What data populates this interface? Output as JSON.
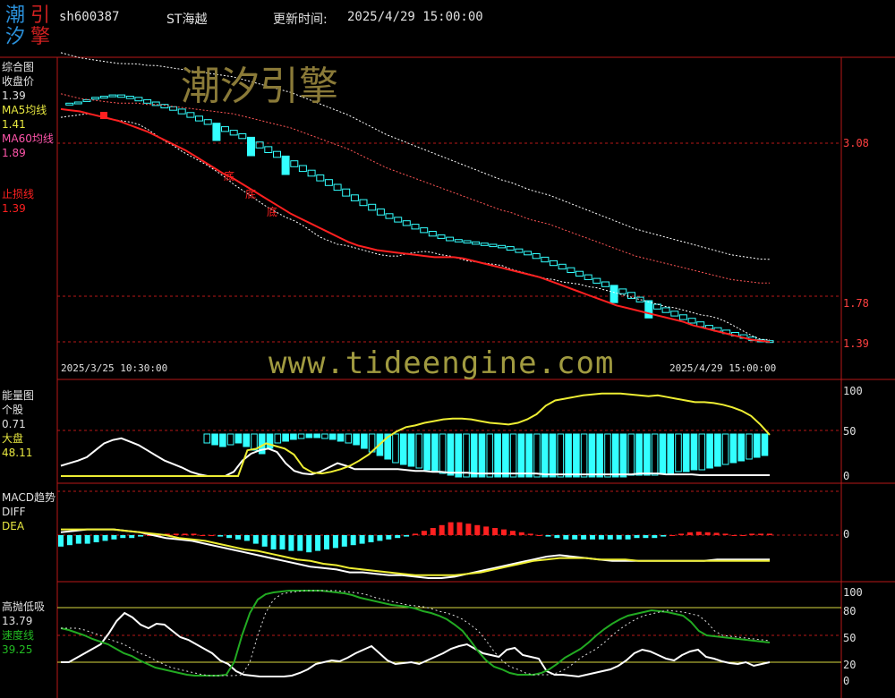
{
  "header": {
    "logo": {
      "c1": "潮",
      "c2": "引",
      "c3": "汐",
      "c4": "擎"
    },
    "code": "sh600387",
    "name": "ST海越",
    "update_label": "更新时间:",
    "update_value": "2025/4/29 15:00:00"
  },
  "watermark": {
    "brand": "潮汐引擎",
    "website": "www.tideengine.com"
  },
  "colors": {
    "bg": "#000000",
    "frame": "#b81818",
    "candle": "#33ffff",
    "ma5": "#ffffff",
    "ma60": "#ff5555",
    "stoploss": "#ff2020",
    "energy_stock": "#ffffff",
    "energy_market": "#eeee33",
    "macd_diff": "#ffffff",
    "macd_dea": "#eeee33",
    "macd_pos": "#ff2020",
    "macd_neg": "#33ffff",
    "sell_buy": "#ffffff",
    "speed": "#22aa22"
  },
  "panel1": {
    "labels": {
      "title": "综合图",
      "close": "收盘价",
      "close_val": "1.39",
      "ma5": "MA5均线",
      "ma5_val": "1.41",
      "ma60": "MA60均线",
      "ma60_val": "1.89",
      "stop": "止损线",
      "stop_val": "1.39"
    },
    "bottom_marker": "底",
    "date_start": "2025/3/25 10:30:00",
    "date_end": "2025/4/29 15:00:00"
  },
  "panel2": {
    "labels": {
      "title": "能量图",
      "stock": "个股",
      "stock_val": "0.71",
      "market": "大盘",
      "market_val": "48.11"
    }
  },
  "panel3": {
    "labels": {
      "title": "MACD趋势",
      "diff": "DIFF",
      "dea": "DEA"
    }
  },
  "panel4": {
    "labels": {
      "title": "高抛低吸",
      "val1": "13.79",
      "speed": "速度线",
      "speed_val": "39.25"
    }
  },
  "chart_data": [
    {
      "type": "candlestick",
      "title": "综合图",
      "y_ticks": [
        "3.08",
        "1.78",
        "1.39"
      ],
      "ylim": [
        1.3,
        3.75
      ],
      "series": [
        {
          "name": "收盘价",
          "values": [
            3.4,
            3.42,
            3.43,
            3.45,
            3.47,
            3.48,
            3.48,
            3.47,
            3.46,
            3.44,
            3.42,
            3.4,
            3.38,
            3.36,
            3.33,
            3.3,
            3.27,
            3.24,
            3.21,
            3.18,
            3.15,
            3.12,
            3.08,
            3.04,
            3.0,
            2.96,
            2.92,
            2.88,
            2.84,
            2.8,
            2.76,
            2.72,
            2.68,
            2.63,
            2.59,
            2.55,
            2.51,
            2.47,
            2.44,
            2.41,
            2.38,
            2.35,
            2.32,
            2.29,
            2.27,
            2.25,
            2.24,
            2.23,
            2.22,
            2.21,
            2.2,
            2.19,
            2.17,
            2.15,
            2.13,
            2.1,
            2.07,
            2.04,
            2.01,
            1.98,
            1.95,
            1.92,
            1.89,
            1.86,
            1.83,
            1.8,
            1.76,
            1.73,
            1.7,
            1.67,
            1.64,
            1.61,
            1.58,
            1.55,
            1.52,
            1.5,
            1.48,
            1.46,
            1.44,
            1.42,
            1.4,
            1.39,
            1.39
          ]
        },
        {
          "name": "MA5均线",
          "values": [
            3.3,
            3.31,
            3.32,
            3.33,
            3.32,
            3.3,
            3.28,
            3.27,
            3.26,
            3.24,
            3.2,
            3.15,
            3.1,
            3.06,
            3.01,
            2.97,
            2.93,
            2.89,
            2.84,
            2.79,
            2.73,
            2.68,
            2.63,
            2.58,
            2.53,
            2.49,
            2.45,
            2.42,
            2.38,
            2.33,
            2.28,
            2.25,
            2.22,
            2.21,
            2.19,
            2.17,
            2.15,
            2.13,
            2.12,
            2.12,
            2.14,
            2.15,
            2.16,
            2.15,
            2.13,
            2.12,
            2.1,
            2.08,
            2.07,
            2.06,
            2.05,
            2.04,
            2.01,
            1.99,
            1.97,
            1.95,
            1.93,
            1.92,
            1.9,
            1.89,
            1.88,
            1.86,
            1.85,
            1.83,
            1.81,
            1.79,
            1.77,
            1.75,
            1.73,
            1.71,
            1.69,
            1.68,
            1.66,
            1.64,
            1.62,
            1.61,
            1.59,
            1.56,
            1.52,
            1.48,
            1.44,
            1.41,
            1.41
          ]
        },
        {
          "name": "MA60均线",
          "values": [
            3.5,
            3.48,
            3.46,
            3.45,
            3.44,
            3.43,
            3.42,
            3.42,
            3.42,
            3.41,
            3.41,
            3.4,
            3.39,
            3.38,
            3.37,
            3.36,
            3.35,
            3.34,
            3.33,
            3.31,
            3.29,
            3.27,
            3.25,
            3.23,
            3.21,
            3.18,
            3.15,
            3.12,
            3.09,
            3.06,
            3.03,
            2.99,
            2.95,
            2.91,
            2.87,
            2.84,
            2.81,
            2.78,
            2.75,
            2.72,
            2.69,
            2.66,
            2.63,
            2.6,
            2.57,
            2.54,
            2.51,
            2.49,
            2.46,
            2.43,
            2.41,
            2.39,
            2.36,
            2.33,
            2.3,
            2.27,
            2.24,
            2.21,
            2.18,
            2.15,
            2.12,
            2.1,
            2.08,
            2.06,
            2.04,
            2.02,
            2.0,
            1.98,
            1.96,
            1.94,
            1.92,
            1.91,
            1.9,
            1.89,
            1.89
          ]
        },
        {
          "name": "止损线",
          "values": [
            3.37,
            3.36,
            3.35,
            3.33,
            3.31,
            3.29,
            3.27,
            3.24,
            3.21,
            3.18,
            3.14,
            3.1,
            3.06,
            3.02,
            2.97,
            2.92,
            2.87,
            2.82,
            2.78,
            2.73,
            2.68,
            2.63,
            2.58,
            2.53,
            2.48,
            2.44,
            2.4,
            2.36,
            2.32,
            2.28,
            2.24,
            2.21,
            2.19,
            2.17,
            2.16,
            2.15,
            2.14,
            2.13,
            2.12,
            2.11,
            2.11,
            2.11,
            2.1,
            2.08,
            2.06,
            2.04,
            2.02,
            2.0,
            1.98,
            1.96,
            1.94,
            1.91,
            1.88,
            1.85,
            1.82,
            1.79,
            1.76,
            1.73,
            1.7,
            1.68,
            1.66,
            1.64,
            1.62,
            1.6,
            1.58,
            1.56,
            1.53,
            1.51,
            1.49,
            1.47,
            1.45,
            1.43,
            1.41,
            1.4,
            1.39
          ]
        }
      ]
    },
    {
      "type": "bar",
      "title": "能量图",
      "y_ticks": [
        "100",
        "50",
        "0"
      ],
      "ylim": [
        0,
        100
      ],
      "series": [
        {
          "name": "个股",
          "values": [
            12,
            15,
            18,
            22,
            30,
            38,
            42,
            44,
            40,
            36,
            30,
            24,
            18,
            14,
            10,
            5,
            2,
            0,
            0,
            0,
            5,
            18,
            26,
            30,
            32,
            28,
            15,
            6,
            3,
            2,
            5,
            10,
            15,
            12,
            8,
            8,
            8,
            8,
            8,
            8,
            7,
            6,
            6,
            5,
            5,
            4,
            4,
            4,
            3,
            3,
            3,
            3,
            3,
            3,
            3,
            3,
            2,
            2,
            2,
            2,
            2,
            2,
            2,
            2,
            2,
            2,
            2,
            3,
            3,
            3,
            2,
            2,
            2,
            2,
            1,
            1,
            1,
            1,
            1,
            1,
            1,
            1,
            1
          ]
        },
        {
          "name": "大盘",
          "values": [
            0,
            0,
            0,
            0,
            0,
            0,
            0,
            0,
            0,
            0,
            0,
            0,
            0,
            0,
            0,
            0,
            0,
            0,
            0,
            0,
            30,
            32,
            38,
            35,
            32,
            25,
            10,
            4,
            3,
            5,
            8,
            12,
            18,
            25,
            35,
            45,
            52,
            57,
            59,
            62,
            64,
            66,
            67,
            67,
            66,
            64,
            62,
            61,
            60,
            62,
            66,
            72,
            82,
            88,
            90,
            92,
            94,
            95,
            96,
            96,
            96,
            95,
            94,
            93,
            94,
            92,
            90,
            88,
            86,
            86,
            85,
            83,
            80,
            76,
            70,
            60,
            48
          ]
        },
        {
          "name": "柱",
          "values": [
            -10,
            -12,
            -14,
            -12,
            -10,
            -14,
            -18,
            -22,
            -16,
            -10,
            -8,
            -6,
            -5,
            -4,
            -4,
            -5,
            -6,
            -8,
            -10,
            -12,
            -16,
            -20,
            -24,
            -28,
            -32,
            -34,
            -36,
            -38,
            -40,
            -42,
            -44,
            -46,
            -48,
            -48,
            -48,
            -48,
            -48,
            -48,
            -48,
            -48,
            -48,
            -48,
            -48,
            -48,
            -48,
            -48,
            -48,
            -48,
            -48,
            -48,
            -48,
            -48,
            -48,
            -48,
            -46,
            -46,
            -46,
            -46,
            -44,
            -44,
            -42,
            -42,
            -40,
            -40,
            -38,
            -36,
            -34,
            -32,
            -30,
            -28,
            -26,
            -24
          ]
        }
      ]
    },
    {
      "type": "line",
      "title": "MACD趋势",
      "y_ticks": [
        "0"
      ],
      "series": [
        {
          "name": "DIFF",
          "values": [
            0.01,
            0.015,
            0.02,
            0.02,
            0.02,
            0.015,
            0.01,
            0,
            -0.01,
            -0.015,
            -0.02,
            -0.03,
            -0.04,
            -0.05,
            -0.06,
            -0.07,
            -0.08,
            -0.09,
            -0.1,
            -0.11,
            -0.115,
            -0.12,
            -0.13,
            -0.13,
            -0.135,
            -0.14,
            -0.14,
            -0.145,
            -0.15,
            -0.15,
            -0.145,
            -0.135,
            -0.125,
            -0.115,
            -0.105,
            -0.095,
            -0.085,
            -0.075,
            -0.07,
            -0.075,
            -0.08,
            -0.085,
            -0.09,
            -0.09,
            -0.09,
            -0.09,
            -0.09,
            -0.09,
            -0.09,
            -0.09,
            -0.085,
            -0.085,
            -0.085,
            -0.085,
            -0.085
          ]
        },
        {
          "name": "DEA",
          "values": [
            0.02,
            0.02,
            0.02,
            0.02,
            0.02,
            0.015,
            0.01,
            0.005,
            0,
            -0.01,
            -0.015,
            -0.02,
            -0.03,
            -0.04,
            -0.05,
            -0.055,
            -0.065,
            -0.075,
            -0.085,
            -0.09,
            -0.1,
            -0.105,
            -0.115,
            -0.12,
            -0.125,
            -0.13,
            -0.135,
            -0.14,
            -0.14,
            -0.14,
            -0.14,
            -0.135,
            -0.13,
            -0.12,
            -0.11,
            -0.1,
            -0.09,
            -0.085,
            -0.08,
            -0.08,
            -0.08,
            -0.085,
            -0.085,
            -0.085,
            -0.09,
            -0.09,
            -0.09,
            -0.09,
            -0.09,
            -0.09,
            -0.09,
            -0.09,
            -0.09,
            -0.09,
            -0.09
          ]
        },
        {
          "name": "MACD柱",
          "values": [
            -0.04,
            -0.035,
            -0.03,
            -0.03,
            -0.025,
            -0.02,
            -0.015,
            -0.01,
            -0.01,
            -0.005,
            0,
            0,
            0.005,
            0.005,
            0.005,
            0.005,
            0,
            0,
            -0.005,
            -0.01,
            -0.015,
            -0.02,
            -0.03,
            -0.04,
            -0.05,
            -0.05,
            -0.055,
            -0.055,
            -0.06,
            -0.055,
            -0.05,
            -0.045,
            -0.04,
            -0.035,
            -0.03,
            -0.025,
            -0.02,
            -0.015,
            -0.01,
            -0.005,
            0.005,
            0.015,
            0.025,
            0.035,
            0.045,
            0.045,
            0.04,
            0.035,
            0.03,
            0.025,
            0.02,
            0.015,
            0.01,
            0.005,
            0,
            -0.005,
            -0.01,
            -0.015,
            -0.015,
            -0.015,
            -0.015,
            -0.015,
            -0.015,
            -0.015,
            -0.015,
            -0.01,
            -0.01,
            -0.01,
            -0.005,
            0,
            0.005,
            0.01,
            0.012,
            0.01,
            0.008,
            0.005,
            0,
            0,
            0.005,
            0.005,
            0.005
          ]
        }
      ]
    },
    {
      "type": "line",
      "title": "高抛低吸",
      "y_ticks": [
        "100",
        "80",
        "50",
        "20",
        "0"
      ],
      "ylim": [
        0,
        100
      ],
      "series": [
        {
          "name": "高抛低吸",
          "values": [
            20,
            20,
            25,
            30,
            35,
            40,
            52,
            66,
            75,
            70,
            62,
            58,
            63,
            62,
            55,
            48,
            45,
            40,
            35,
            30,
            22,
            18,
            10,
            6,
            5,
            4,
            4,
            4,
            4,
            5,
            8,
            12,
            18,
            20,
            22,
            21,
            25,
            30,
            34,
            38,
            30,
            22,
            18,
            19,
            20,
            18,
            22,
            26,
            30,
            35,
            38,
            40,
            35,
            30,
            28,
            26,
            34,
            36,
            28,
            26,
            24,
            10,
            6,
            6,
            5,
            4,
            6,
            8,
            10,
            12,
            16,
            22,
            30,
            34,
            32,
            28,
            24,
            22,
            28,
            32,
            34,
            26,
            24,
            21,
            19,
            18,
            20,
            16,
            18,
            20
          ]
        },
        {
          "name": "速度线",
          "values": [
            58,
            56,
            53,
            50,
            46,
            43,
            40,
            35,
            30,
            27,
            22,
            18,
            14,
            12,
            10,
            8,
            6,
            5,
            5,
            5,
            5,
            6,
            20,
            50,
            75,
            90,
            96,
            98,
            99,
            100,
            100,
            100,
            100,
            100,
            99,
            98,
            97,
            95,
            92,
            90,
            88,
            86,
            84,
            83,
            82,
            80,
            77,
            75,
            72,
            68,
            62,
            55,
            44,
            32,
            22,
            15,
            12,
            8,
            6,
            6,
            6,
            8,
            12,
            18,
            25,
            30,
            35,
            42,
            50,
            57,
            63,
            68,
            72,
            74,
            76,
            78,
            77,
            76,
            74,
            72,
            65,
            55,
            50,
            49,
            48,
            47,
            46,
            45,
            44,
            43,
            42
          ]
        }
      ]
    }
  ]
}
